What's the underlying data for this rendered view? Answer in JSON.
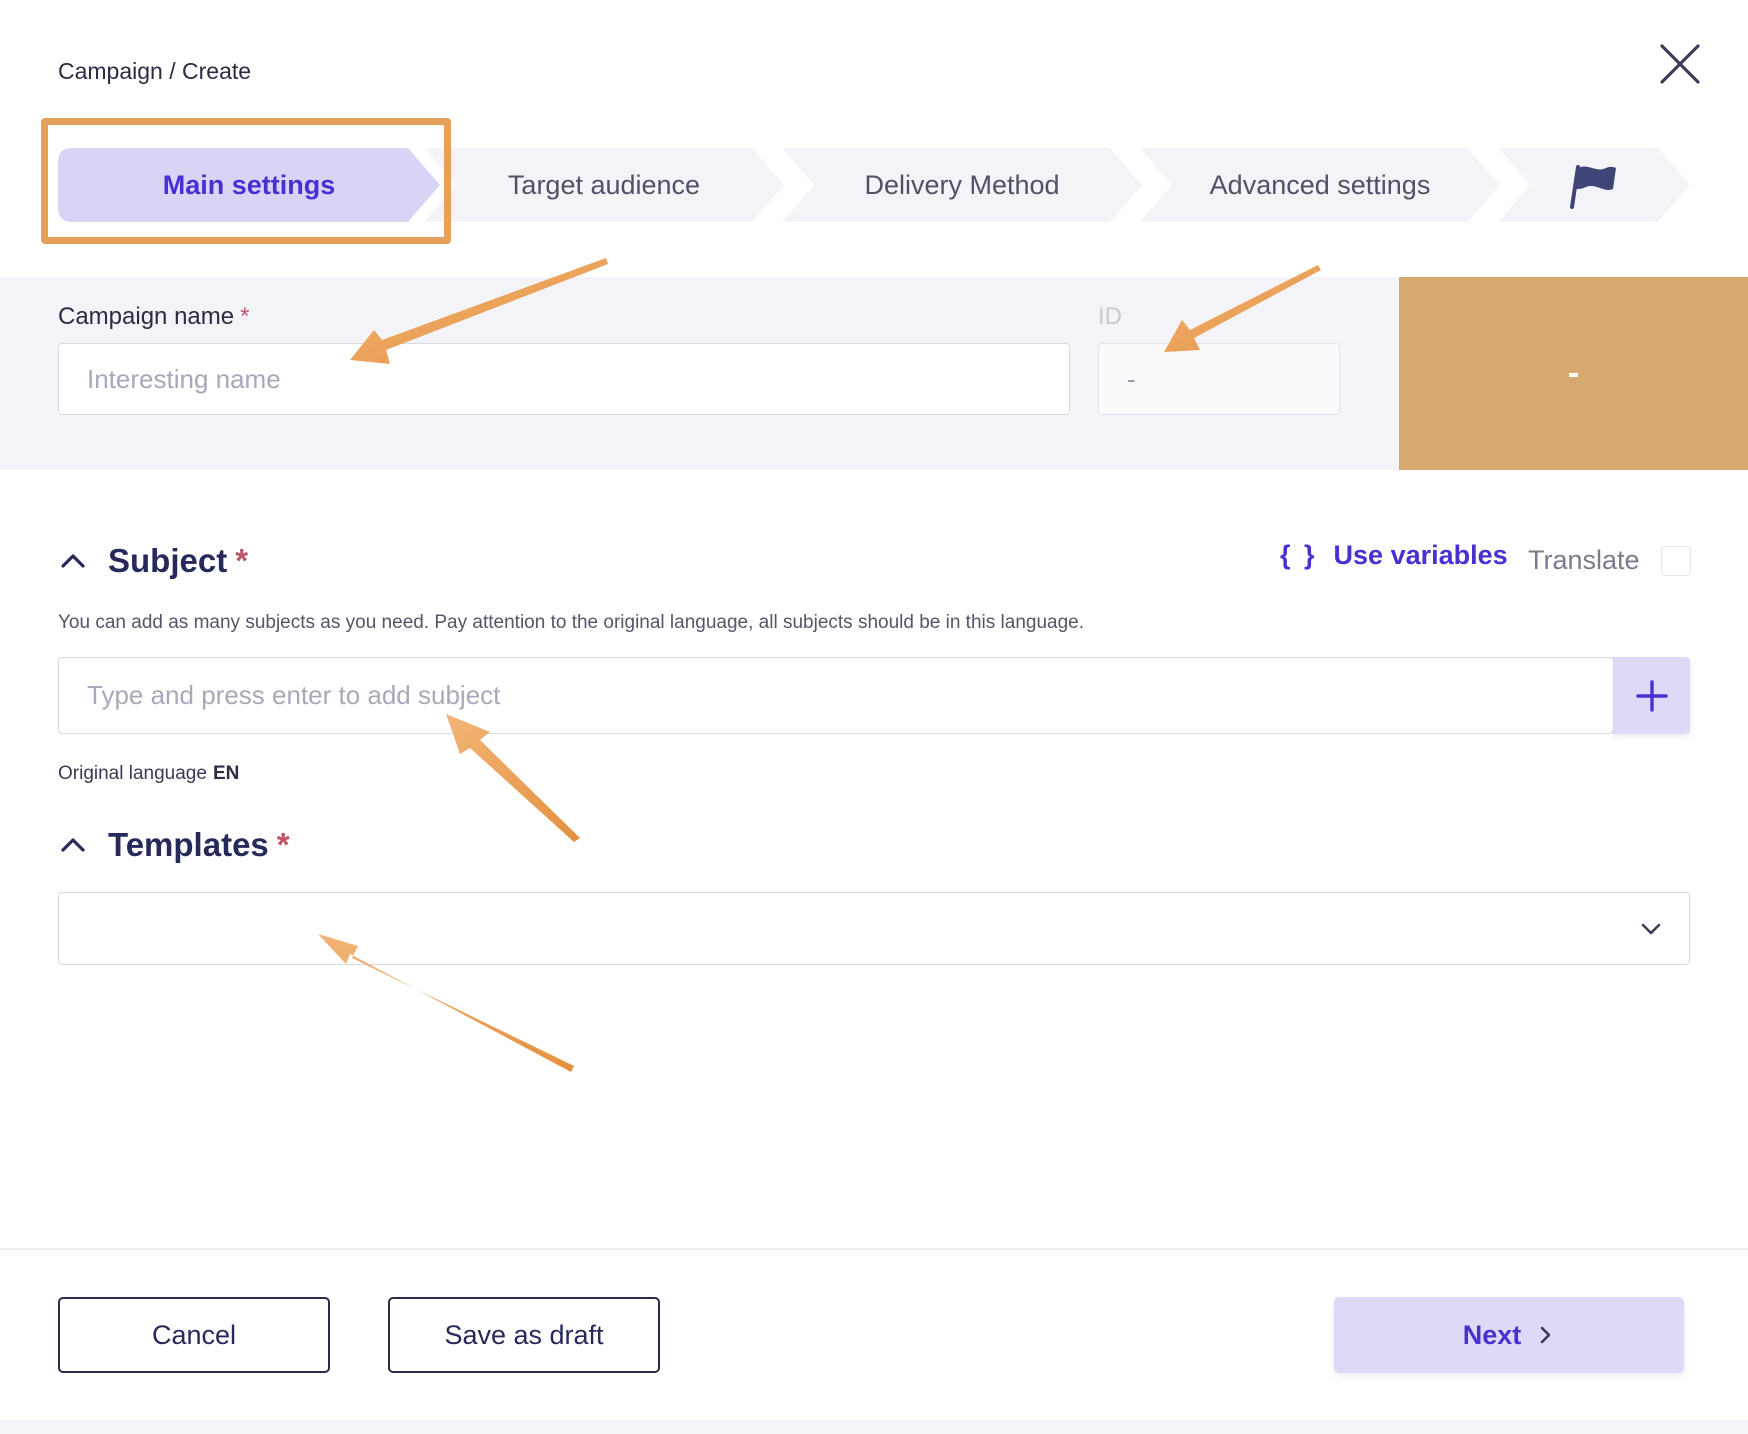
{
  "header": {
    "breadcrumb": "Campaign / Create"
  },
  "stepper": {
    "steps": [
      {
        "label": "Main settings",
        "active": true
      },
      {
        "label": "Target audience",
        "active": false
      },
      {
        "label": "Delivery Method",
        "active": false
      },
      {
        "label": "Advanced settings",
        "active": false
      }
    ],
    "final_icon": "flag-icon"
  },
  "campaign": {
    "name_label": "Campaign name",
    "required_mark": "*",
    "name_placeholder": "Interesting name",
    "id_label": "ID",
    "id_value": "-",
    "side_value": "-"
  },
  "subject": {
    "title": "Subject",
    "required_mark": "*",
    "use_variables_braces": "{ }",
    "use_variables_label": "Use variables",
    "translate_label": "Translate",
    "hint": "You can add as many subjects as you need. Pay attention to the original language, all subjects should be in this language.",
    "input_placeholder": "Type and press enter to add subject",
    "original_language_label": "Original language",
    "original_language_value": "EN"
  },
  "templates": {
    "title": "Templates",
    "required_mark": "*"
  },
  "footer": {
    "cancel_label": "Cancel",
    "draft_label": "Save as draft",
    "next_label": "Next"
  },
  "colors": {
    "accent": "#4a2fd1",
    "active_step_bg": "#d8d4f6",
    "step_bg": "#f4f4f8",
    "annotation_orange": "#e5a05c",
    "side_panel": "#d6aa6f",
    "required": "#c0556a"
  }
}
